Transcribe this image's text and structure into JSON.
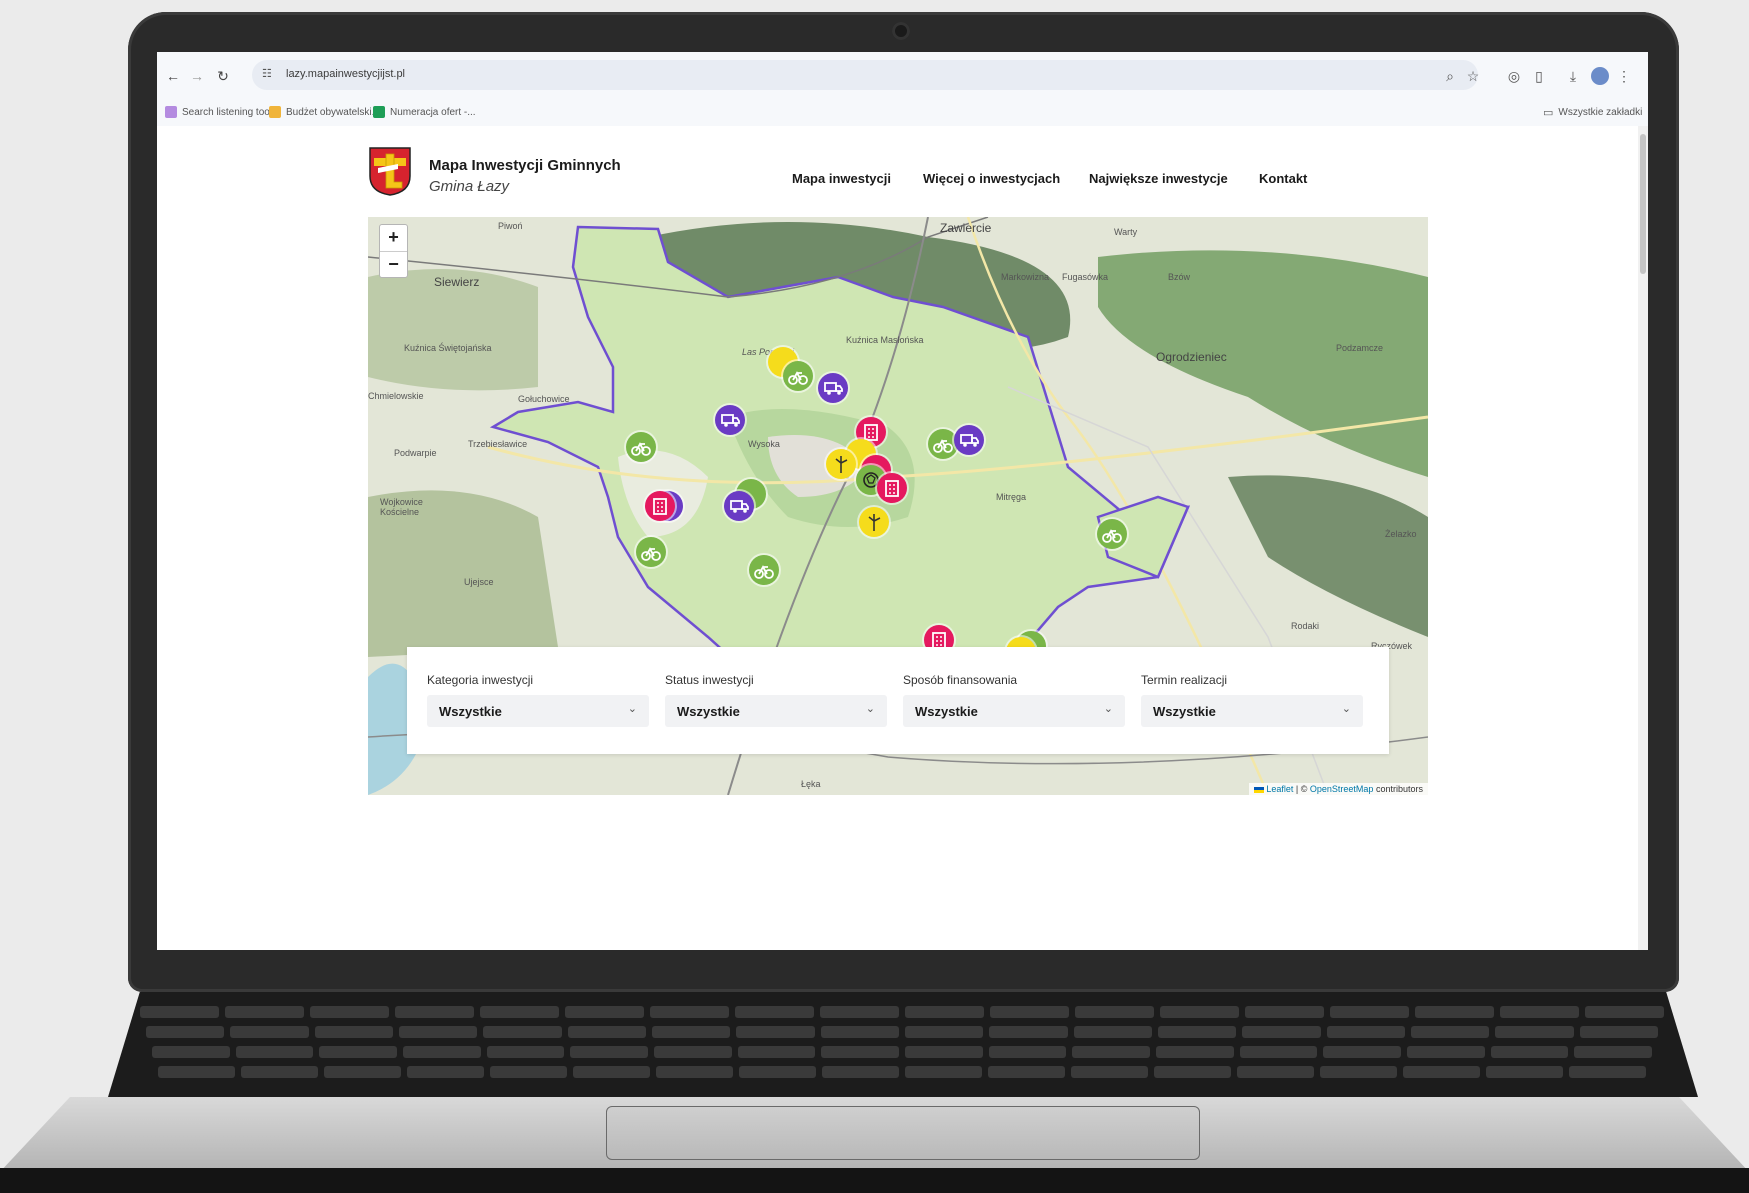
{
  "browser": {
    "url": "lazy.mapainwestycjijst.pl",
    "bookmarks": [
      "Search listening too...",
      "Budżet obywatelski...",
      "Numeracja ofert -..."
    ],
    "all_bookmarks_label": "Wszystkie zakładki"
  },
  "site": {
    "title": "Mapa Inwestycji Gminnych",
    "subtitle": "Gmina Łazy",
    "nav": [
      "Mapa inwestycji",
      "Więcej o inwestycjach",
      "Największe inwestycje",
      "Kontakt"
    ]
  },
  "map": {
    "zoom_in_label": "+",
    "zoom_out_label": "−",
    "attribution": {
      "leaflet": "Leaflet",
      "separator": "| ©",
      "osm": "OpenStreetMap",
      "suffix": "contributors"
    },
    "place_labels": [
      "Zawiercie",
      "Siewierz",
      "Ogrodzieniec",
      "Kuźnica Świętojańska",
      "Chmielowskie",
      "Gołuchowice",
      "Trzebiesławice",
      "Podwarpie",
      "Wojkowice Kościelne",
      "Ujejsce",
      "Wysoka",
      "Mitręga",
      "Kuźnica Masłońska",
      "Markowizna",
      "Fugasówka",
      "Bzów",
      "Podzamcze",
      "Warty",
      "Rodaki",
      "Ryczówek",
      "Łęka",
      "Las Porębski",
      "Żelazko",
      "Piwoń"
    ]
  },
  "filters": [
    {
      "label": "Kategoria inwestycji",
      "value": "Wszystkie"
    },
    {
      "label": "Status inwestycji",
      "value": "Wszystkie"
    },
    {
      "label": "Sposób finansowania",
      "value": "Wszystkie"
    },
    {
      "label": "Termin realizacji",
      "value": "Wszystkie"
    }
  ],
  "colors": {
    "marker_green": "#7ab648",
    "marker_purple": "#6a3bc4",
    "marker_pink": "#e5195f",
    "marker_yellow": "#f5dc1c",
    "boundary": "#6f4fd1"
  }
}
